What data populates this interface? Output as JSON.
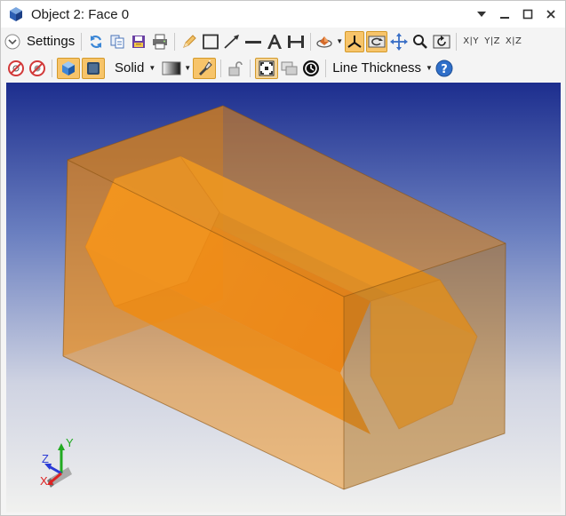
{
  "window": {
    "title": "Object 2: Face 0",
    "controls": [
      "pin-icon",
      "minimize-icon",
      "maximize-icon",
      "close-icon"
    ]
  },
  "toolbar1": {
    "settings_label": "Settings",
    "axis_buttons": [
      "X|Y",
      "Y|Z",
      "X|Z"
    ],
    "icons": [
      "settings-chevron-icon",
      "refresh-icon",
      "copy-icon",
      "save-icon",
      "print-icon",
      "pencil-icon",
      "rectangle-icon",
      "arrow-icon",
      "line-icon",
      "text-icon",
      "dimension-icon",
      "rotate-object-icon",
      "axes-icon",
      "auto-rotate-icon",
      "pan-icon",
      "zoom-icon",
      "reset-view-icon"
    ]
  },
  "toolbar2": {
    "render_mode": "Solid",
    "line_thickness_label": "Line Thickness",
    "icons": [
      "no-rays-icon",
      "no-fill-icon",
      "cube-shaded-icon",
      "cube-dark-icon",
      "gradient-icon",
      "flashlight-icon",
      "lock-icon",
      "fit-view-icon",
      "layers-icon",
      "clock-icon",
      "help-icon"
    ]
  },
  "viewport": {
    "colors": {
      "bg_top": "#1d2e8e",
      "bg_bottom": "#f1f1ef",
      "body": "#f08a14"
    },
    "axis_labels": {
      "x": "X",
      "y": "Y",
      "z": "Z"
    }
  }
}
